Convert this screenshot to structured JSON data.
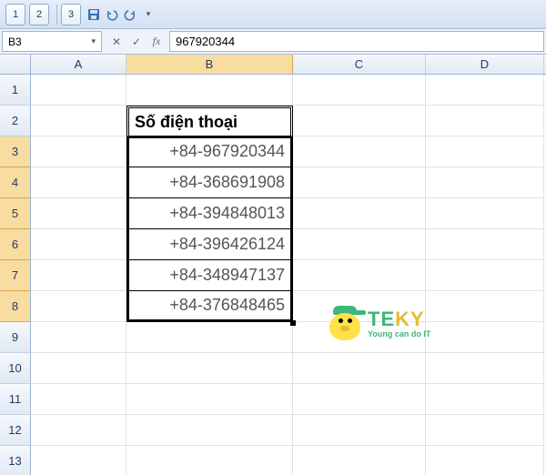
{
  "qat": {
    "view1": "1",
    "view2": "2",
    "view3": "3"
  },
  "namebox": {
    "value": "B3"
  },
  "formula_bar": {
    "value": "967920344"
  },
  "columns": [
    "A",
    "B",
    "C",
    "D"
  ],
  "rows": [
    "1",
    "2",
    "3",
    "4",
    "5",
    "6",
    "7",
    "8",
    "9",
    "10",
    "11",
    "12",
    "13"
  ],
  "active_cell": "B3",
  "table": {
    "header": "Số điện thoại",
    "values": [
      "+84-967920344",
      "+84-368691908",
      "+84-394848013",
      "+84-396426124",
      "+84-348947137",
      "+84-376848465"
    ]
  },
  "logo": {
    "text1": "TE",
    "text2": "KY",
    "sub": "Young can do IT"
  }
}
